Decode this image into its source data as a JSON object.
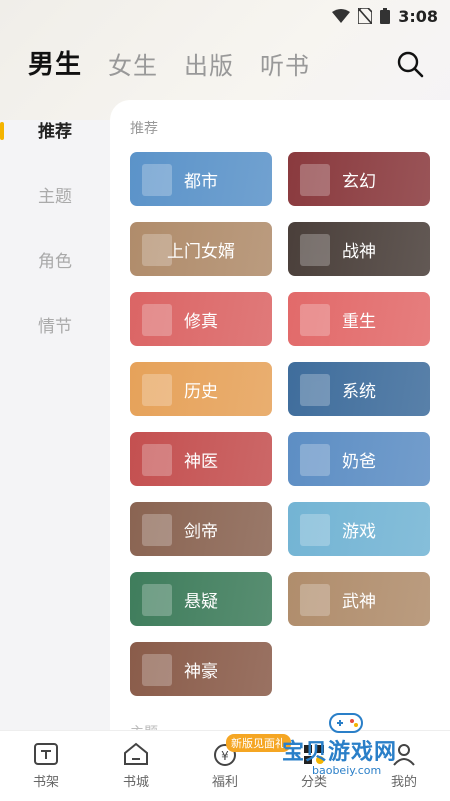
{
  "status": {
    "time": "3:08"
  },
  "tabs": [
    {
      "label": "男生",
      "active": true
    },
    {
      "label": "女生",
      "active": false
    },
    {
      "label": "出版",
      "active": false
    },
    {
      "label": "听书",
      "active": false
    }
  ],
  "sidebar": [
    {
      "label": "推荐",
      "active": true
    },
    {
      "label": "主题",
      "active": false
    },
    {
      "label": "角色",
      "active": false
    },
    {
      "label": "情节",
      "active": false
    }
  ],
  "section": {
    "label": "推荐",
    "next_label": "主题"
  },
  "categories": [
    {
      "label": "都市",
      "color": "#5b93c9"
    },
    {
      "label": "玄幻",
      "color": "#8a3a3e"
    },
    {
      "label": "上门女婿",
      "color": "#b08c6b"
    },
    {
      "label": "战神",
      "color": "#4a3f3a"
    },
    {
      "label": "修真",
      "color": "#db6565"
    },
    {
      "label": "重生",
      "color": "#e26a6a"
    },
    {
      "label": "历史",
      "color": "#e6a25a"
    },
    {
      "label": "系统",
      "color": "#3f6d9c"
    },
    {
      "label": "神医",
      "color": "#c45050"
    },
    {
      "label": "奶爸",
      "color": "#5d8ec4"
    },
    {
      "label": "剑帝",
      "color": "#8a6452"
    },
    {
      "label": "游戏",
      "color": "#73b4d4"
    },
    {
      "label": "悬疑",
      "color": "#3f7d5c"
    },
    {
      "label": "武神",
      "color": "#b08d6c"
    },
    {
      "label": "神豪",
      "color": "#8a5c4a"
    }
  ],
  "bottom_nav": [
    {
      "label": "书架",
      "icon": "bookshelf-icon"
    },
    {
      "label": "书城",
      "icon": "store-icon"
    },
    {
      "label": "福利",
      "icon": "welfare-icon"
    },
    {
      "label": "分类",
      "icon": "category-icon"
    },
    {
      "label": "我的",
      "icon": "profile-icon"
    }
  ],
  "badge": "新版见面礼",
  "watermark": {
    "title": "宝贝游戏网",
    "url": "baobeiy.com"
  }
}
